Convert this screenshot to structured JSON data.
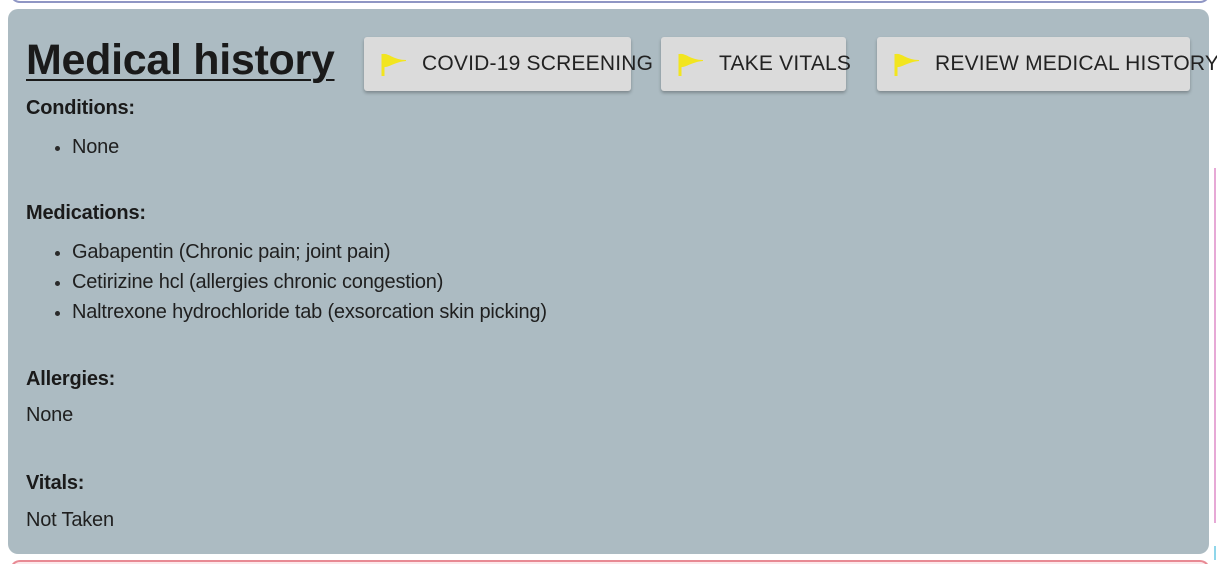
{
  "section": {
    "title": "Medical history"
  },
  "actions": [
    {
      "label": "COVID-19 SCREENING",
      "icon": "flag-icon"
    },
    {
      "label": "TAKE VITALS",
      "icon": "flag-icon"
    },
    {
      "label": "REVIEW MEDICAL HISTORY",
      "icon": "flag-icon"
    }
  ],
  "colors": {
    "card_background": "#acbbc2",
    "button_background": "#dbdbdb",
    "flag": "#f2e51f"
  },
  "conditions": {
    "heading": "Conditions:",
    "items": [
      "None"
    ]
  },
  "medications": {
    "heading": "Medications:",
    "items": [
      "Gabapentin (Chronic pain; joint pain)",
      "Cetirizine hcl (allergies chronic congestion)",
      "Naltrexone hydrochloride tab (exsorcation skin picking)"
    ]
  },
  "allergies": {
    "heading": "Allergies:",
    "value": "None"
  },
  "vitals": {
    "heading": "Vitals:",
    "value": "Not Taken"
  }
}
